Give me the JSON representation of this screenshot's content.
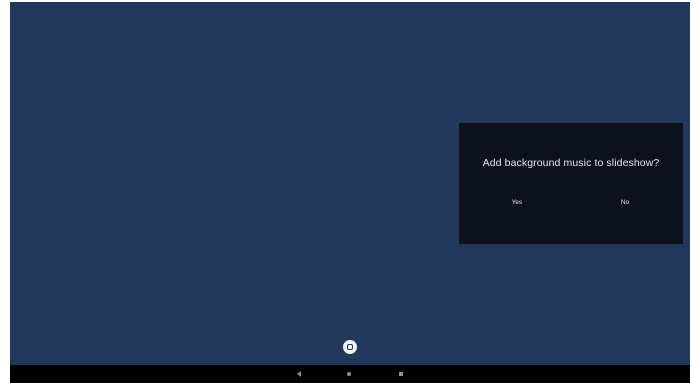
{
  "dialog": {
    "title": "Add background music to slideshow?",
    "yes_label": "Yes",
    "no_label": "No"
  },
  "icons": {
    "fab": "home-square-icon",
    "back": "back-triangle-icon",
    "home": "home-circle-icon",
    "recent": "recents-square-icon"
  },
  "colors": {
    "screen_background": "#23375a",
    "dialog_background": "#0c111d",
    "dialog_text": "#e6e8ec",
    "navbar": "#000000"
  }
}
